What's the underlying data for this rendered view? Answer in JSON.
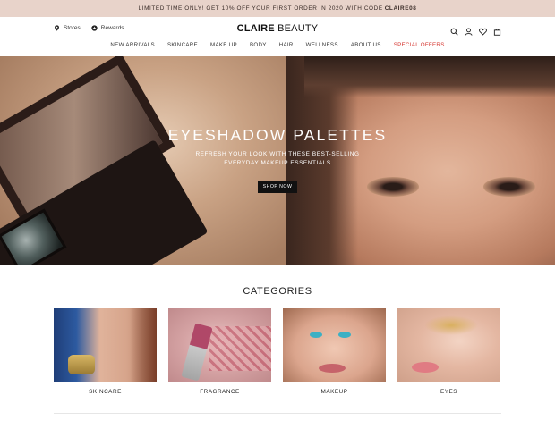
{
  "promo": {
    "text": "LIMITED TIME ONLY! GET 10% OFF YOUR FIRST ORDER IN 2020 WITH CODE",
    "code": "CLAIRE08"
  },
  "header": {
    "stores_label": "Stores",
    "rewards_label": "Rewards",
    "logo_brand": "CLAIRE",
    "logo_word": "BEAUTY",
    "icons": [
      "search-icon",
      "account-icon",
      "heart-icon",
      "bag-icon"
    ]
  },
  "nav": {
    "items": [
      "NEW ARRIVALS",
      "SKINCARE",
      "MAKE UP",
      "BODY",
      "HAIR",
      "WELLNESS",
      "ABOUT US",
      "SPECIAL OFFERS"
    ],
    "highlight_color": "#d5352f"
  },
  "hero": {
    "title": "EYESHADOW PALETTES",
    "subtitle_line1": "REFRESH YOUR LOOK WITH THESE BEST-SELLING",
    "subtitle_line2": "EVERYDAY MAKEUP ESSENTIALS",
    "button_label": "SHOP NOW",
    "slide_count": 3,
    "active_slide": 1
  },
  "categories": {
    "title": "CATEGORIES",
    "items": [
      {
        "label": "SKINCARE"
      },
      {
        "label": "FRAGRANCE"
      },
      {
        "label": "MAKEUP"
      },
      {
        "label": "EYES"
      }
    ]
  },
  "colors": {
    "promo_bg": "#e8d3ca",
    "button_bg": "#111111",
    "accent_red": "#d5352f"
  }
}
